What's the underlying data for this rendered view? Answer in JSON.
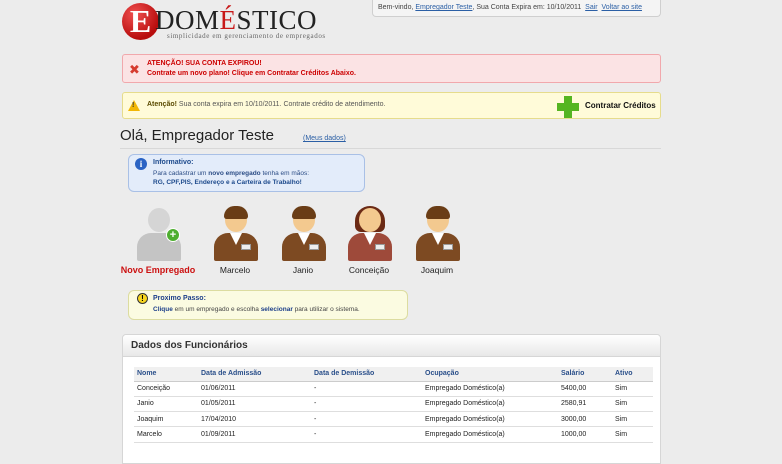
{
  "brand": {
    "logo_letter": "E",
    "logo_word_prefix": "DOM",
    "logo_word_accent": "É",
    "logo_word_suffix": "STICO",
    "tagline": "simplicidade em gerenciamento de empregados"
  },
  "userbar": {
    "welcome": "Bem-vindo,",
    "user_name": "Empregador Teste",
    "expires_text": ", Sua Conta Expira em: 10/10/2011",
    "logout": "Sair",
    "back_to_site": "Voltar ao site"
  },
  "alert_expired": {
    "line1": "ATENÇÃO! SUA CONTA EXPIROU!",
    "line2": "Contrate um novo plano! Clique em Contratar Créditos Abaixo."
  },
  "alert_warning": {
    "bold": "Atenção!",
    "text": " Sua conta expira em 10/10/2011. Contrate crédito de atendimento.",
    "button": "Contratar Créditos"
  },
  "greeting": {
    "title": "Olá, Empregador Teste",
    "my_data_link": "(Meus dados)"
  },
  "info_box": {
    "title": "Informativo:",
    "line1_a": "Para cadastrar um ",
    "line1_b": "novo empregado",
    "line1_c": " tenha em mãos:",
    "line2": "RG, CPF,PIS, Endereço e a Carteira de Trabalho!"
  },
  "employees_cards": [
    {
      "label": "Novo Empregado"
    },
    {
      "label": "Marcelo"
    },
    {
      "label": "Janio"
    },
    {
      "label": "Conceição"
    },
    {
      "label": "Joaquim"
    }
  ],
  "next_step": {
    "title": "Proximo Passo:",
    "a": "Clique",
    "b": " em um empregado e escolha ",
    "c": "selecionar",
    "d": " para utilizar o sistema."
  },
  "table": {
    "title": "Dados dos Funcionários",
    "headers": [
      "Nome",
      "Data de Admissão",
      "Data de Demissão",
      "Ocupação",
      "Salário",
      "Ativo"
    ],
    "rows": [
      [
        "Conceição",
        "01/06/2011",
        "-",
        "Empregado Doméstico(a)",
        "5400,00",
        "Sim"
      ],
      [
        "Janio",
        "01/05/2011",
        "-",
        "Empregado Doméstico(a)",
        "2580,91",
        "Sim"
      ],
      [
        "Joaquim",
        "17/04/2010",
        "-",
        "Empregado Doméstico(a)",
        "3000,00",
        "Sim"
      ],
      [
        "Marcelo",
        "01/09/2011",
        "-",
        "Empregado Doméstico(a)",
        "1000,00",
        "Sim"
      ]
    ]
  },
  "colors": {
    "brand_red": "#c81818",
    "link_blue": "#2b5fa5",
    "add_green": "#55b521"
  }
}
